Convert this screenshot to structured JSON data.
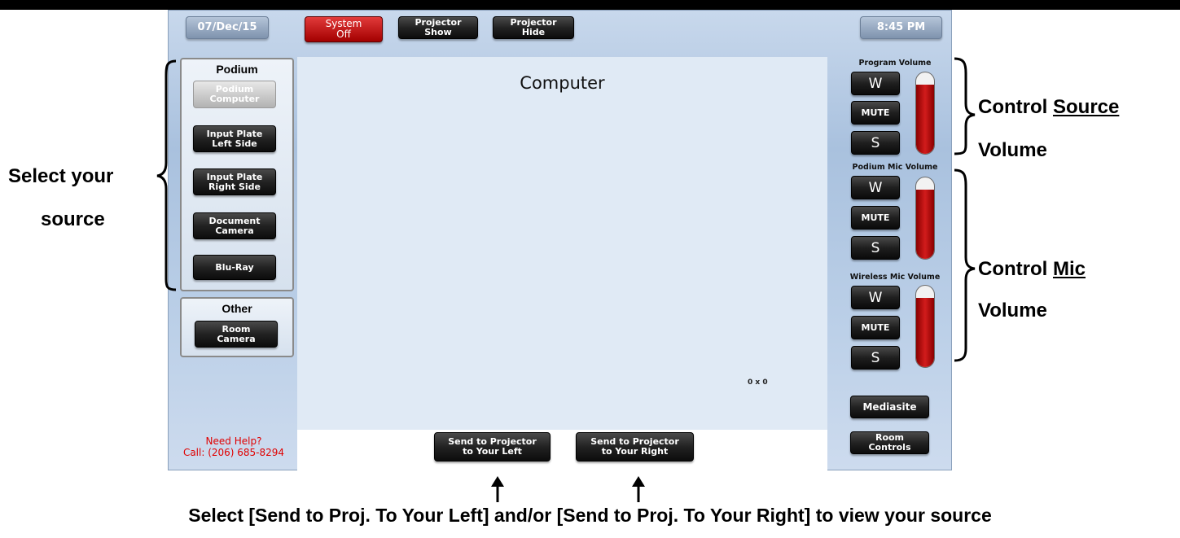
{
  "header": {
    "date": "07/Dec/15",
    "system_off": "System\nOff",
    "projector_show": "Projector\nShow",
    "projector_hide": "Projector\nHide",
    "time": "8:45 PM"
  },
  "podium_group": {
    "title": "Podium",
    "items": [
      {
        "label": "Podium\nComputer",
        "selected": true
      },
      {
        "label": "Input Plate\nLeft Side"
      },
      {
        "label": "Input Plate\nRight Side"
      },
      {
        "label": "Document\nCamera"
      },
      {
        "label": "Blu-Ray"
      }
    ]
  },
  "other_group": {
    "title": "Other",
    "items": [
      {
        "label": "Room\nCamera"
      }
    ]
  },
  "display": {
    "title": "Computer",
    "resolution": "0 x 0"
  },
  "help": {
    "line1": "Need Help?",
    "line2": "Call: (206) 685-8294"
  },
  "send_buttons": {
    "left": "Send to Projector\nto Your Left",
    "right": "Send to Projector\nto Your Right"
  },
  "volumes": [
    {
      "title": "Program Volume",
      "up": "W",
      "mute": "MUTE",
      "down": "S",
      "level": 0.85
    },
    {
      "title": "Podium Mic Volume",
      "up": "W",
      "mute": "MUTE",
      "down": "S",
      "level": 0.85
    },
    {
      "title": "Wireless Mic Volume",
      "up": "W",
      "mute": "MUTE",
      "down": "S",
      "level": 0.85
    }
  ],
  "right_buttons": {
    "mediasite": "Mediasite",
    "room_controls": "Room\nControls"
  },
  "annotations": {
    "select_source_1": "Select your",
    "select_source_2": "source",
    "control_source_1a": "Control ",
    "control_source_1b": "Source",
    "control_source_2": "Volume",
    "control_mic_1a": "Control ",
    "control_mic_1b": "Mic",
    "control_mic_2": "Volume",
    "bottom_instruction": "Select [Send to Proj. To Your Left] and/or [Send to Proj. To Your Right] to view your source"
  }
}
